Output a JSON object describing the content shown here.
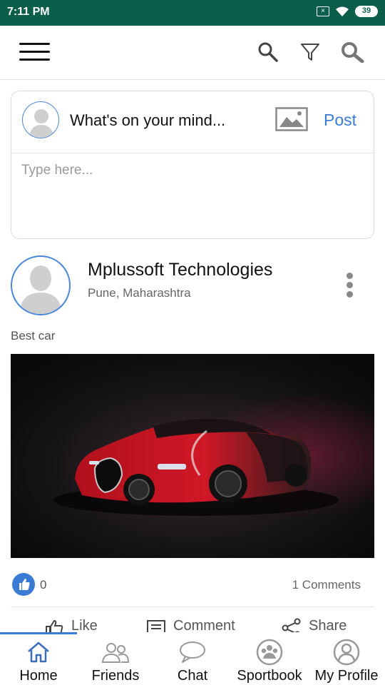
{
  "status_bar": {
    "time": "7:11 PM",
    "battery": "39",
    "sim": "×"
  },
  "composer": {
    "prompt": "What's on your mind...",
    "post_label": "Post",
    "placeholder": "Type here..."
  },
  "post": {
    "author": "Mplussoft Technologies",
    "location": "Pune, Maharashtra",
    "caption": "Best car",
    "like_count": "0",
    "comments": "1 Comments",
    "actions": {
      "like": "Like",
      "comment": "Comment",
      "share": "Share"
    }
  },
  "bottom_nav": {
    "items": [
      {
        "label": "Home",
        "icon": "home-icon"
      },
      {
        "label": "Friends",
        "icon": "friends-icon"
      },
      {
        "label": "Chat",
        "icon": "chat-icon"
      },
      {
        "label": "Sportbook",
        "icon": "paw-group-icon"
      },
      {
        "label": "My Profile",
        "icon": "profile-icon"
      }
    ],
    "active": "Home"
  },
  "colors": {
    "status_bar": "#0b5e4a",
    "accent": "#3a7bd5"
  }
}
